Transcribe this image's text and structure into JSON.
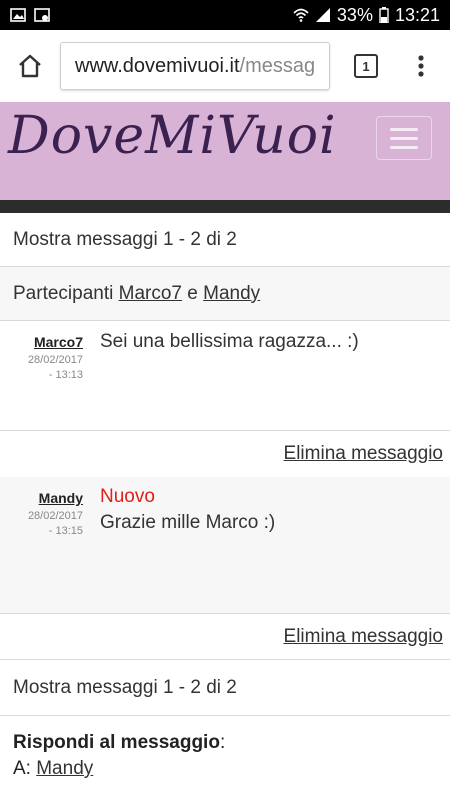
{
  "status_bar": {
    "battery": "33%",
    "time": "13:21",
    "icons": [
      "gallery-icon",
      "screenshot-icon",
      "wifi-icon",
      "signal-icon",
      "battery-icon"
    ]
  },
  "browser": {
    "url_host": "www.dovemivuoi.it",
    "url_path": "/messag",
    "tab_count": "1",
    "icons": [
      "home-icon",
      "tabs-icon",
      "overflow-menu-icon"
    ]
  },
  "site": {
    "logo": "DoveMiVuoi",
    "header_color": "#d9b3d6",
    "logo_color": "#3b2150"
  },
  "thread": {
    "summary": "Mostra messaggi 1 - 2 di 2",
    "participants_label": "Partecipanti",
    "participant_1": "Marco7",
    "participants_and": "e",
    "participant_2": "Mandy",
    "messages": [
      {
        "author": "Marco7",
        "date": "28/02/2017",
        "time": "- 13:13",
        "badge": "",
        "text": "Sei una bellissima ragazza... :)",
        "delete_label": "Elimina messaggio"
      },
      {
        "author": "Mandy",
        "date": "28/02/2017",
        "time": "- 13:15",
        "badge": "Nuovo",
        "text": "Grazie mille Marco :)",
        "delete_label": "Elimina messaggio"
      }
    ],
    "summary_bottom": "Mostra messaggi 1 - 2 di 2"
  },
  "reply": {
    "title": "Rispondi al messaggio",
    "title_suffix": ":",
    "to_label": "A:",
    "to_name": "Mandy"
  }
}
